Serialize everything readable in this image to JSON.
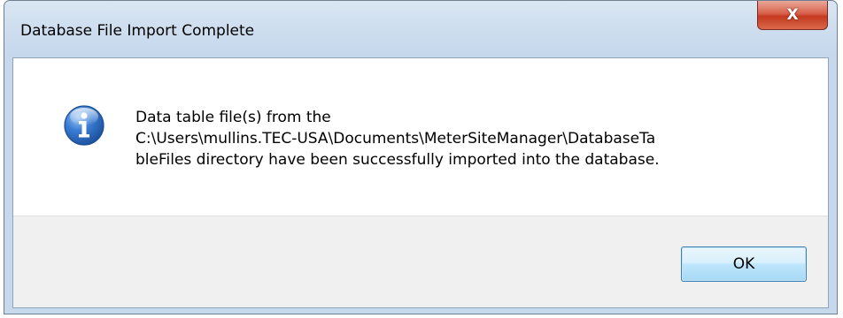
{
  "dialog": {
    "title": "Database File Import Complete",
    "close_glyph": "X",
    "message_lines": [
      "Data table file(s) from the",
      "C:\\Users\\mullins.TEC-USA\\Documents\\MeterSiteManager\\DatabaseTa",
      "bleFiles directory have been successfully imported into the database."
    ],
    "icon": "information-icon",
    "ok_label": "OK"
  },
  "colors": {
    "info_icon_blue": "#2f6fc4",
    "close_red": "#c4391f",
    "button_blue_border": "#3c7fb1"
  }
}
